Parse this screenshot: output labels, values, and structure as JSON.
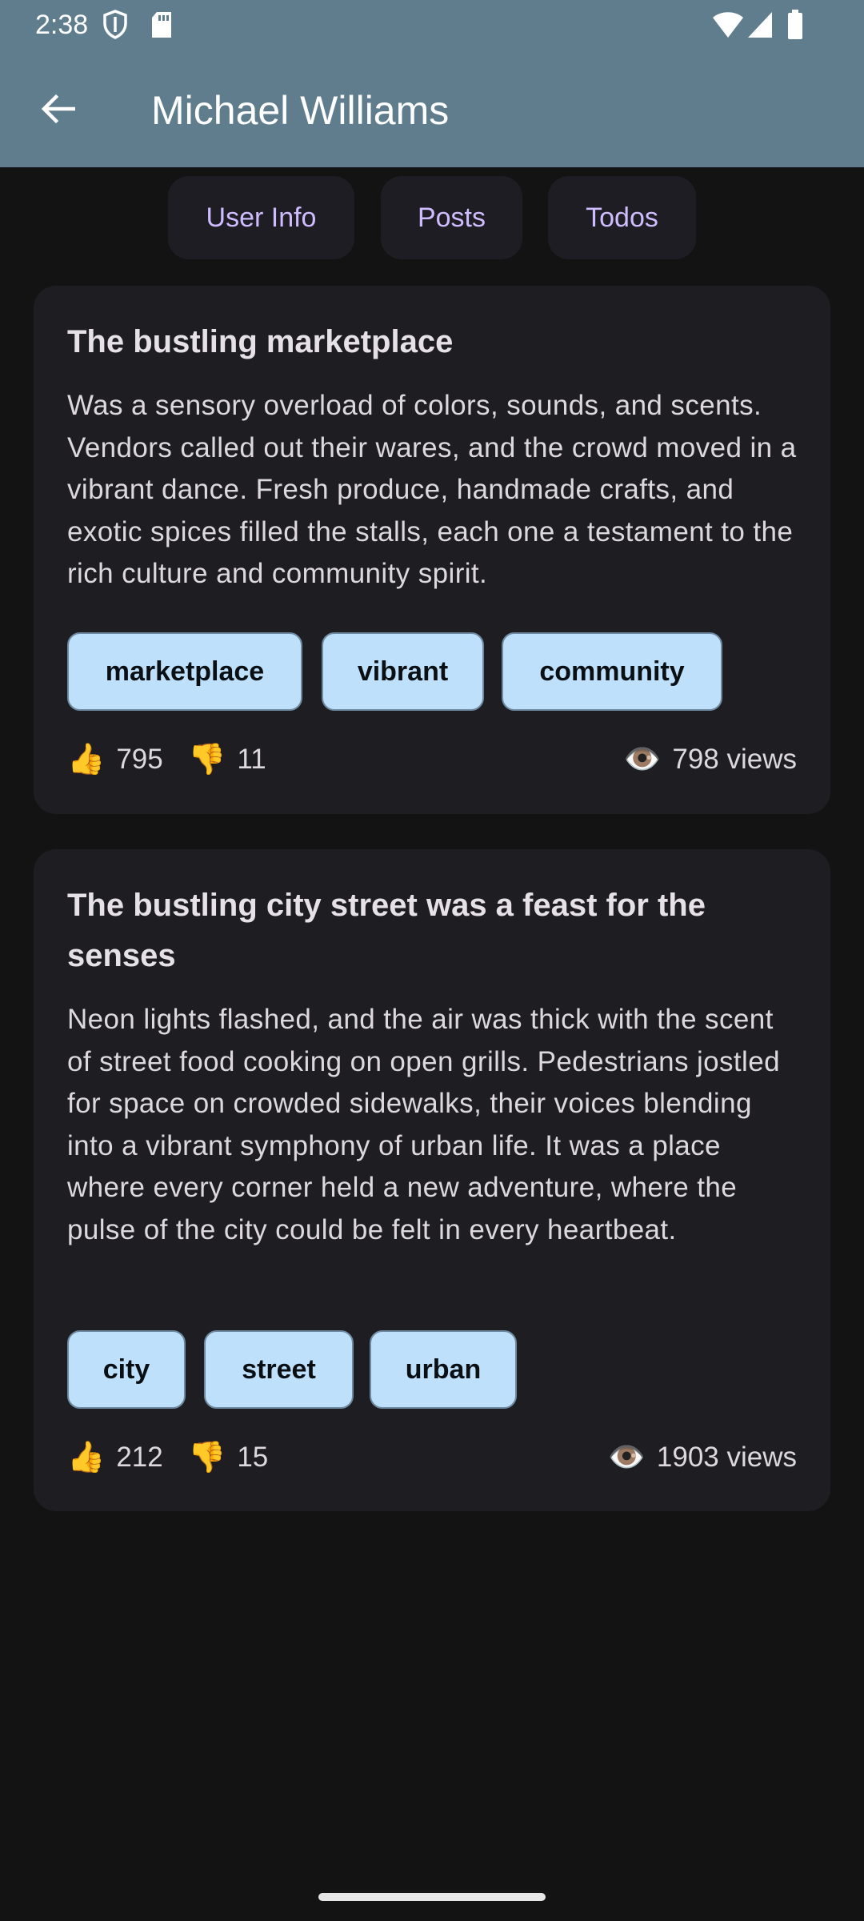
{
  "status_bar": {
    "time": "2:38"
  },
  "app_bar": {
    "title": "Michael Williams",
    "back_icon": "arrow-left-icon"
  },
  "tabs": [
    {
      "label": "User Info"
    },
    {
      "label": "Posts"
    },
    {
      "label": "Todos"
    }
  ],
  "posts": [
    {
      "title": "The bustling marketplace",
      "body": "Was a sensory overload of colors, sounds, and scents. Vendors called out their wares, and the crowd moved in a vibrant dance. Fresh produce, handmade crafts, and exotic spices filled the stalls, each one a testament to the rich culture and community spirit.",
      "tags": [
        "marketplace",
        "vibrant",
        "community"
      ],
      "likes": "795",
      "dislikes": "11",
      "views": "798 views"
    },
    {
      "title": "The bustling city street was a feast for the senses",
      "body": "Neon lights flashed, and the air was thick with the scent of street food cooking on open grills. Pedestrians jostled for space on crowded sidewalks, their voices blending into a vibrant symphony of urban life. It was a place where every corner held a new adventure, where the pulse of the city could be felt in every heartbeat.",
      "tags": [
        "city",
        "street",
        "urban"
      ],
      "likes": "212",
      "dislikes": "15",
      "views": "1903 views"
    }
  ],
  "icons": {
    "like": "👍",
    "dislike": "👎",
    "views": "👁️"
  },
  "colors": {
    "app_bar": "#5f7d8d",
    "background": "#131313",
    "card": "#1e1d22",
    "tab_text": "#cfbcff",
    "chip": "#bfe0fa"
  }
}
